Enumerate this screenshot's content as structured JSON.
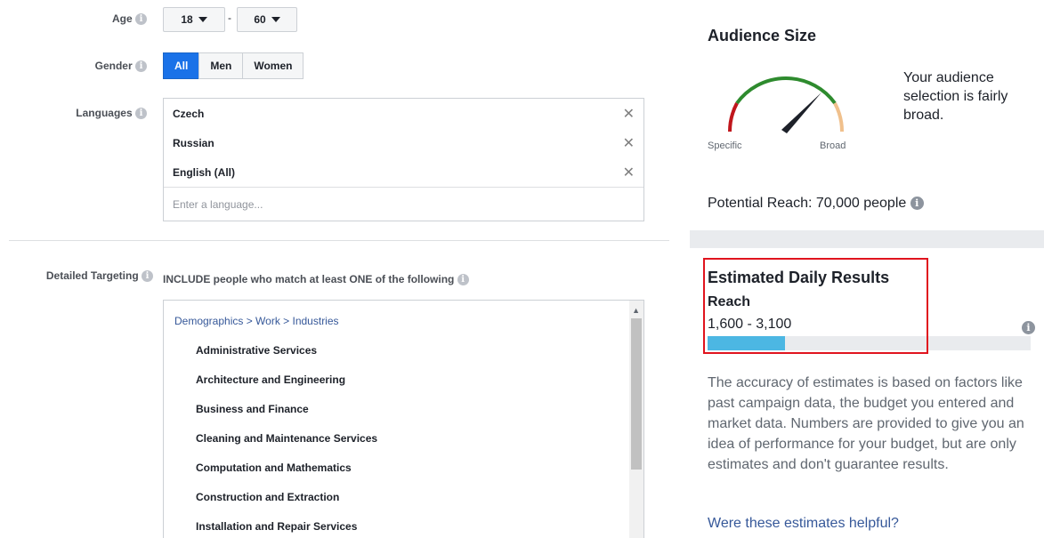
{
  "age": {
    "label": "Age",
    "min": "18",
    "max": "60",
    "dash": "-"
  },
  "gender": {
    "label": "Gender",
    "options": [
      "All",
      "Men",
      "Women"
    ],
    "selected": "All"
  },
  "languages": {
    "label": "Languages",
    "items": [
      "Czech",
      "Russian",
      "English (All)"
    ],
    "placeholder": "Enter a language..."
  },
  "detailed_targeting": {
    "label": "Detailed Targeting",
    "include_text": "INCLUDE people who match at least ONE of the following",
    "breadcrumb": "Demographics > Work > Industries",
    "items": [
      "Administrative Services",
      "Architecture and Engineering",
      "Business and Finance",
      "Cleaning and Maintenance Services",
      "Computation and Mathematics",
      "Construction and Extraction",
      "Installation and Repair Services"
    ]
  },
  "audience": {
    "title": "Audience Size",
    "specific_label": "Specific",
    "broad_label": "Broad",
    "description": "Your audience selection is fairly broad.",
    "potential_reach": "Potential Reach: 70,000 people"
  },
  "estimated": {
    "title": "Estimated Daily Results",
    "reach_label": "Reach",
    "reach_range": "1,600 - 3,100",
    "reach_fill_fraction": 0.24,
    "accuracy_text": "The accuracy of estimates is based on factors like past campaign data, the budget you entered and market data. Numbers are provided to give you an idea of performance for your budget, but are only estimates and don't guarantee results.",
    "helpful_link": "Were these estimates helpful?"
  },
  "colors": {
    "accent": "#1a72e8",
    "link": "#365899",
    "reach_bar": "#4cb7e3",
    "highlight": "#e0141e",
    "gauge_green": "#2e8b2e",
    "gauge_red": "#c0161c",
    "gauge_orange": "#f0c08c"
  }
}
